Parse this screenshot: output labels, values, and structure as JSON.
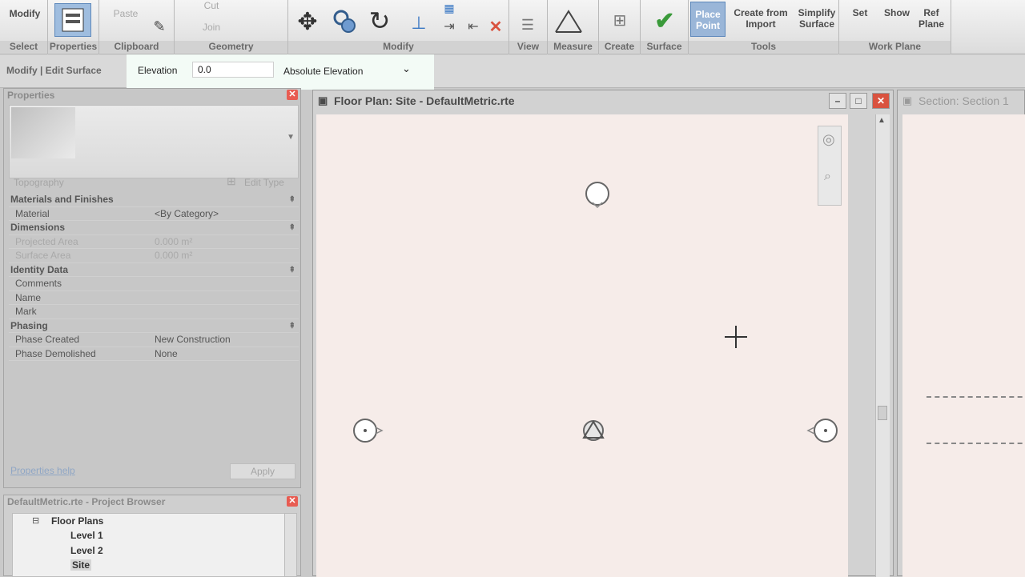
{
  "ribbon": {
    "groups": [
      {
        "label": "Select",
        "buttons": [
          "Modify"
        ]
      },
      {
        "label": "Properties",
        "buttons": []
      },
      {
        "label": "Clipboard",
        "buttons": [
          "Paste"
        ]
      },
      {
        "label": "Geometry",
        "buttons": [
          "Cut",
          "Join"
        ]
      },
      {
        "label": "Modify",
        "buttons": []
      },
      {
        "label": "View",
        "buttons": []
      },
      {
        "label": "Measure",
        "buttons": []
      },
      {
        "label": "Create",
        "buttons": []
      },
      {
        "label": "Surface",
        "buttons": []
      },
      {
        "label": "Tools",
        "buttons": [
          "Place Point",
          "Create from Import",
          "Simplify Surface"
        ]
      },
      {
        "label": "Work Plane",
        "buttons": [
          "Set",
          "Show",
          "Ref Plane"
        ]
      }
    ]
  },
  "options_bar": {
    "context": "Modify | Edit Surface",
    "elevation_label": "Elevation",
    "elevation_value": "0.0",
    "elevation_mode": "Absolute Elevation"
  },
  "properties": {
    "title": "Properties",
    "type_selector": "Topography",
    "edit_type": "Edit Type",
    "rows": [
      {
        "kind": "section",
        "label": "Materials and Finishes"
      },
      {
        "kind": "row",
        "key": "Material",
        "value": "<By Category>"
      },
      {
        "kind": "section",
        "label": "Dimensions"
      },
      {
        "kind": "dim",
        "key": "Projected Area",
        "value": "0.000 m²"
      },
      {
        "kind": "dim",
        "key": "Surface Area",
        "value": "0.000 m²"
      },
      {
        "kind": "section",
        "label": "Identity Data"
      },
      {
        "kind": "row",
        "key": "Comments",
        "value": ""
      },
      {
        "kind": "row",
        "key": "Name",
        "value": ""
      },
      {
        "kind": "row",
        "key": "Mark",
        "value": ""
      },
      {
        "kind": "section",
        "label": "Phasing"
      },
      {
        "kind": "row",
        "key": "Phase Created",
        "value": "New Construction"
      },
      {
        "kind": "row",
        "key": "Phase Demolished",
        "value": "None"
      }
    ],
    "help_link": "Properties help",
    "apply_label": "Apply"
  },
  "project_browser": {
    "title": "DefaultMetric.rte - Project Browser",
    "tree": [
      "Floor Plans",
      "Level 1",
      "Level 2",
      "Site"
    ]
  },
  "view_main": {
    "title": "Floor Plan: Site - DefaultMetric.rte"
  },
  "view_side": {
    "title": "Section: Section 1"
  },
  "colors": {
    "canvas": "#f6ece9",
    "accent": "#3a78c4",
    "close": "#d9523f"
  }
}
